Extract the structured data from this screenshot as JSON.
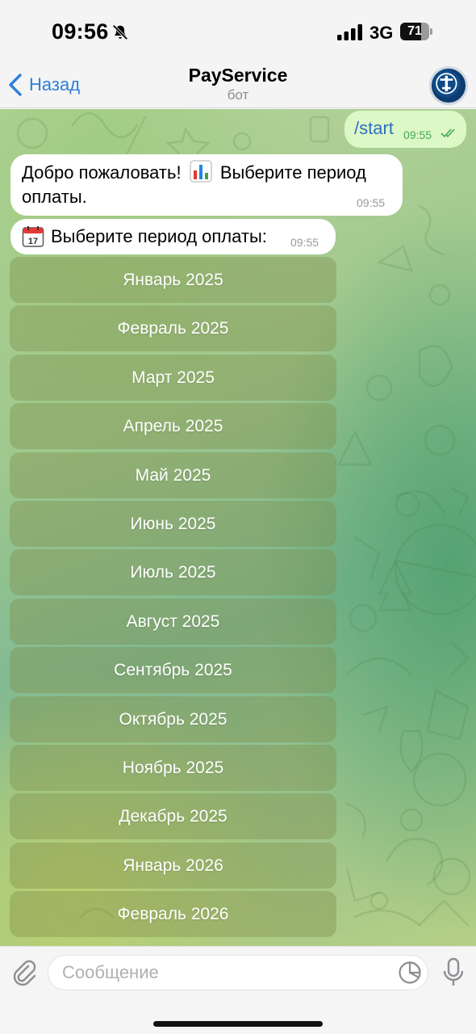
{
  "status_bar": {
    "time": "09:56",
    "network": "3G",
    "battery_level": "71",
    "battery_fraction": 0.71,
    "icons": [
      "bell-slash-icon",
      "signal-icon"
    ]
  },
  "header": {
    "back_label": "Назад",
    "title": "PayService",
    "subtitle": "бот",
    "avatar_icon": "bot-avatar-icon"
  },
  "messages": [
    {
      "direction": "out",
      "text": "/start",
      "time": "09:55",
      "status": "read"
    },
    {
      "direction": "in",
      "text_before": "Добро пожаловать! ",
      "emoji": "chart-icon",
      "text_after": " Выберите период оплаты.",
      "time": "09:55"
    },
    {
      "direction": "in",
      "emoji": "calendar-icon",
      "text": "Выберите период оплаты:",
      "time": "09:55"
    }
  ],
  "keyboard": {
    "buttons": [
      "Январь 2025",
      "Февраль 2025",
      "Март 2025",
      "Апрель 2025",
      "Май 2025",
      "Июнь 2025",
      "Июль 2025",
      "Август 2025",
      "Сентябрь 2025",
      "Октябрь 2025",
      "Ноябрь 2025",
      "Декабрь 2025",
      "Январь 2026",
      "Февраль 2026"
    ]
  },
  "input": {
    "placeholder": "Сообщение",
    "value": ""
  },
  "colors": {
    "accent": "#2f7fd6",
    "outgoing_bubble": "#dcf8c6",
    "incoming_bubble": "#ffffff",
    "read_check": "#4aa55a"
  }
}
